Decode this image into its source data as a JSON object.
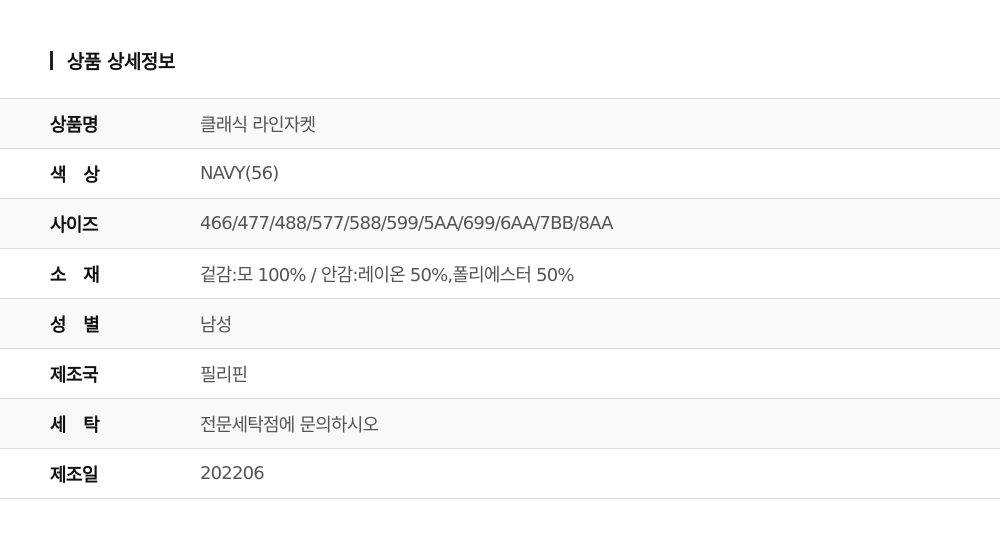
{
  "section": {
    "title": "상품 상세정보"
  },
  "specs": [
    {
      "label": "상품명",
      "value": "클래식 라인자켓"
    },
    {
      "label": "색   상",
      "value": "NAVY(56)"
    },
    {
      "label": "사이즈",
      "value": "466/477/488/577/588/599/5AA/699/6AA/7BB/8AA"
    },
    {
      "label": "소   재",
      "value": "겉감:모 100% / 안감:레이온 50%,폴리에스터 50%"
    },
    {
      "label": "성   별",
      "value": "남성"
    },
    {
      "label": "제조국",
      "value": "필리핀"
    },
    {
      "label": "세   탁",
      "value": "전문세탁점에 문의하시오"
    },
    {
      "label": "제조일",
      "value": "202206"
    }
  ]
}
